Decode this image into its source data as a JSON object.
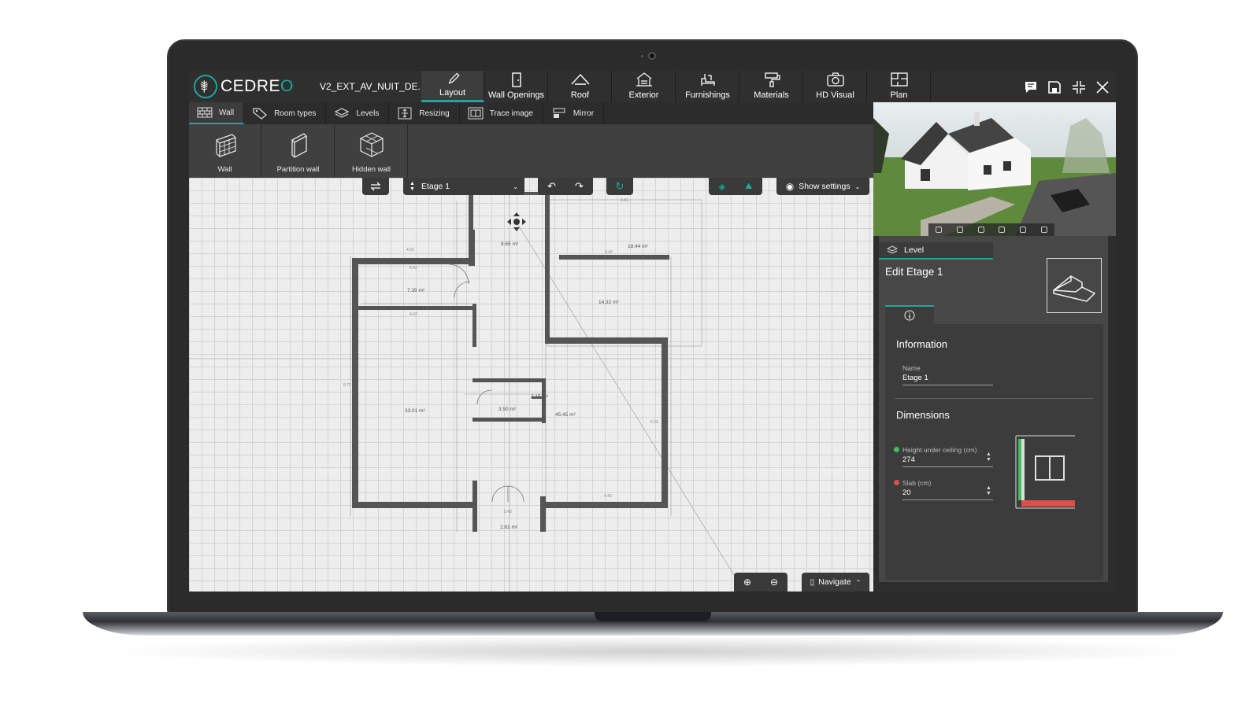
{
  "app": {
    "logo": "CEDREO",
    "project_name": "V2_EXT_AV_NUIT_DE..."
  },
  "colors": {
    "accent": "#1aa89a",
    "topbar_bg": "#2f2f2f",
    "canvas_bg": "#ededed",
    "height_dot": "#3fbf5f",
    "slab_dot": "#e04d4d"
  },
  "main_tabs": [
    {
      "label": "Layout",
      "icon": "pencil-icon"
    },
    {
      "label": "Wall Openings",
      "icon": "door-icon"
    },
    {
      "label": "Roof",
      "icon": "roof-icon"
    },
    {
      "label": "Exterior",
      "icon": "exterior-icon"
    },
    {
      "label": "Furnishings",
      "icon": "furniture-icon"
    },
    {
      "label": "Materials",
      "icon": "paint-roller-icon"
    },
    {
      "label": "HD Visual",
      "icon": "camera-icon"
    },
    {
      "label": "Plan",
      "icon": "plan-icon"
    }
  ],
  "sub_tabs": [
    {
      "label": "Wall",
      "icon": "brick-icon"
    },
    {
      "label": "Room types",
      "icon": "tag-icon"
    },
    {
      "label": "Levels",
      "icon": "layers-icon"
    },
    {
      "label": "Resizing",
      "icon": "resize-icon"
    },
    {
      "label": "Trace image",
      "icon": "trace-icon"
    },
    {
      "label": "Mirror",
      "icon": "mirror-icon"
    }
  ],
  "tools": [
    {
      "label": "Wall"
    },
    {
      "label": "Partition wall"
    },
    {
      "label": "Hidden wall"
    }
  ],
  "canvas_controls": {
    "level_select": "Etage 1",
    "show_settings": "Show settings",
    "navigate": "Navigate"
  },
  "plan": {
    "room_areas": [
      "8.65 m²",
      "18.44 m²",
      "7.39 m²",
      "14.32 m²",
      "33.01 m²",
      "3.50 m²",
      "2.15 m²",
      "45.45 m²",
      "2.81 m²"
    ],
    "dims": [
      "4.55",
      "4.42",
      "4.42",
      "4.81",
      "4.42",
      "8.72",
      "6.12",
      "4.42",
      "5.43"
    ]
  },
  "panel": {
    "level_tab": "Level",
    "edit_title": "Edit Etage 1",
    "information_title": "Information",
    "name_label": "Name",
    "name_value": "Etage 1",
    "dimensions_title": "Dimensions",
    "height_label": "Height under ceiling (cm)",
    "height_value": "274",
    "slab_label": "Slab (cm)",
    "slab_value": "20"
  }
}
